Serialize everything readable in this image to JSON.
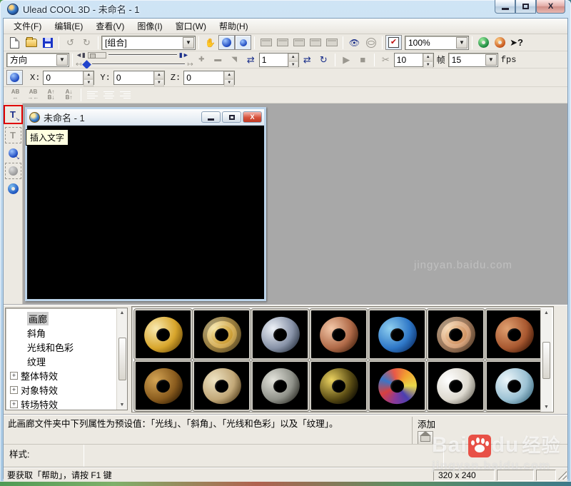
{
  "window": {
    "title": "Ulead COOL 3D - 未命名 - 1"
  },
  "menu": {
    "items": [
      {
        "label": "文件(F)"
      },
      {
        "label": "编辑(E)"
      },
      {
        "label": "查看(V)"
      },
      {
        "label": "图像(I)"
      },
      {
        "label": "窗口(W)"
      },
      {
        "label": "帮助(H)"
      }
    ]
  },
  "toolbar1": {
    "group_combo_value": "[组合]",
    "zoom_combo_value": "100%",
    "undo_glyph": "↺",
    "redo_glyph": "↻",
    "hand_glyph": "✋",
    "eye_glyph": "👁",
    "check_glyph": "✔",
    "help_glyph": "➤?"
  },
  "toolbar2": {
    "direction_combo_value": "方向",
    "frame_value": "1",
    "duration_value": "10",
    "frame_unit_label": "帧",
    "fps_combo_value": "15",
    "fps_label": "fps",
    "prev_glyph": "◄▮",
    "next_glyph": "▮►",
    "back_glyph": "↤",
    "fwd_glyph": "↦",
    "add_glyph": "✚",
    "del_glyph": "▬",
    "skew_glyph": "◥",
    "loop_glyph": "⇄",
    "cycle_glyph": "↻",
    "play_glyph": "▶",
    "stop_glyph": "■",
    "record_glyph": "✂"
  },
  "position_bar": {
    "x_label": "X:",
    "x_value": "0",
    "y_label": "Y:",
    "y_value": "0",
    "z_label": "Z:",
    "z_value": "0"
  },
  "typography": {
    "expand_top": "AB",
    "expand_bottom": "↔",
    "condense_top": "AB",
    "condense_bottom": "→←",
    "linesp_inc_top": "A↑",
    "linesp_inc_bottom": "B↓",
    "linesp_dec_top": "A↓",
    "linesp_dec_bottom": "B↑"
  },
  "left_toolbar": {
    "insert_text_glyph": "T",
    "tooltip": "插入文字"
  },
  "child_window": {
    "title": "未命名 - 1",
    "canvas_color": "#000000"
  },
  "tree": {
    "items": [
      {
        "label": "画廊",
        "selected": true
      },
      {
        "label": "斜角"
      },
      {
        "label": "光线和色彩"
      },
      {
        "label": "纹理"
      },
      {
        "label": "整体特效",
        "expand": "+"
      },
      {
        "label": "对象特效",
        "expand": "+"
      },
      {
        "label": "转场特效",
        "expand": "+"
      }
    ]
  },
  "gallery": {
    "items": [
      {
        "name": "gold-torus",
        "highlight": "#f8e9b0",
        "base": "#d8a62c",
        "shadow": "#6b4a08"
      },
      {
        "name": "gold-ring-torus",
        "highlight": "#f4e2a0",
        "base": "#c9992f",
        "shadow": "#5f4408",
        "ring": true
      },
      {
        "name": "chrome-torus",
        "highlight": "#eef2f8",
        "base": "#8893a8",
        "shadow": "#232c3a"
      },
      {
        "name": "copper-torus",
        "highlight": "#f4c8a8",
        "base": "#b06a48",
        "shadow": "#401e0c"
      },
      {
        "name": "blue-stone-torus",
        "highlight": "#8fd0f0",
        "base": "#2f78c8",
        "shadow": "#0a2a60"
      },
      {
        "name": "sand-ring-torus",
        "highlight": "#f4d4ac",
        "base": "#cf9060",
        "shadow": "#58300f",
        "ring": true
      },
      {
        "name": "terracotta-torus",
        "highlight": "#e0a070",
        "base": "#a85830",
        "shadow": "#381404"
      },
      {
        "name": "bronze-holes-torus",
        "highlight": "#d4a454",
        "base": "#8a5c1e",
        "shadow": "#2c1902"
      },
      {
        "name": "scale-torus",
        "highlight": "#eee3c2",
        "base": "#c2a878",
        "shadow": "#4d3917"
      },
      {
        "name": "steel-plate-torus",
        "highlight": "#e4e4dc",
        "base": "#90928a",
        "shadow": "#24241e"
      },
      {
        "name": "gold-camo-torus",
        "highlight": "#ecd360",
        "base": "#5a4c14",
        "shadow": "#050401"
      },
      {
        "name": "stained-glass-torus",
        "highlight": "#e85858",
        "base": "#7040a0",
        "shadow": "#1c0e3a",
        "conic": [
          "#e85848",
          "#f2a030",
          "#e8d84a",
          "#4a3fb0",
          "#8a3a9a",
          "#d84040",
          "#3a76c8",
          "#e85848"
        ]
      },
      {
        "name": "plaster-torus",
        "highlight": "#ffffff",
        "base": "#dedad0",
        "shadow": "#68645a"
      },
      {
        "name": "ice-blue-torus",
        "highlight": "#ecf6fa",
        "base": "#9cc2d4",
        "shadow": "#3a687e"
      }
    ]
  },
  "info": {
    "text": "此画廊文件夹中下列属性为预设值：「光线」、「斜角」、「光线和色彩」以及「纹理」。",
    "add_label": "添加"
  },
  "style_row": {
    "label": "样式:"
  },
  "status": {
    "help_text": "要获取「帮助」，请按 F1 键",
    "canvas_size": "320 x 240"
  },
  "watermark": {
    "faint_url": "jingyan.baidu.com",
    "brand_left": "Bai",
    "brand_right": "du",
    "brand_cn": "经验",
    "url": "jingyan.baidu.com"
  }
}
